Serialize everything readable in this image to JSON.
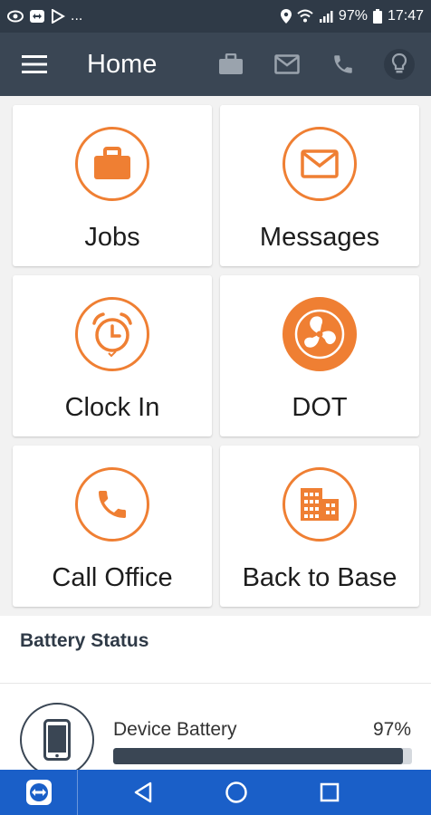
{
  "status_bar": {
    "more": "...",
    "battery": "97%",
    "time": "17:47"
  },
  "app_bar": {
    "title": "Home"
  },
  "tiles": [
    {
      "label": "Jobs",
      "icon": "briefcase-icon"
    },
    {
      "label": "Messages",
      "icon": "mail-icon"
    },
    {
      "label": "Clock In",
      "icon": "alarm-clock-icon"
    },
    {
      "label": "DOT",
      "icon": "dot-logo-icon"
    },
    {
      "label": "Call Office",
      "icon": "phone-icon"
    },
    {
      "label": "Back to Base",
      "icon": "building-icon"
    }
  ],
  "battery": {
    "title": "Battery Status",
    "device_label": "Device Battery",
    "device_percent": "97%",
    "device_level": 0.97
  },
  "colors": {
    "accent": "#ef7f33",
    "app_bar": "#3a4654",
    "status_bar": "#2f3a47",
    "nav_bar": "#1a5fc8"
  }
}
